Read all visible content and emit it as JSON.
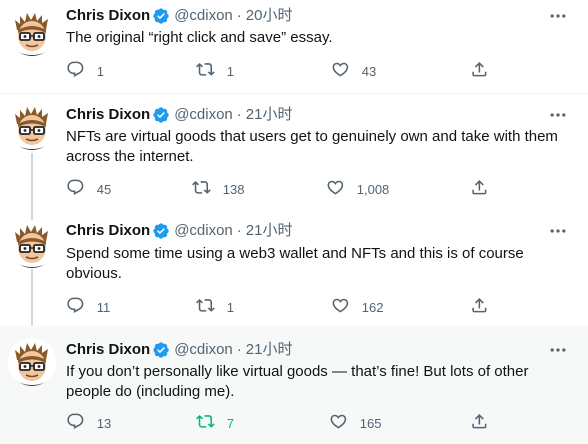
{
  "tweets": [
    {
      "name": "Chris Dixon",
      "handle": "@cdixon",
      "separator": "·",
      "time": "20小时",
      "text": "The original “right click and save” essay.",
      "replies": "1",
      "retweets": "1",
      "likes": "43",
      "retweeted": false
    },
    {
      "name": "Chris Dixon",
      "handle": "@cdixon",
      "separator": "·",
      "time": "21小时",
      "text": "NFTs are virtual goods that users get to genuinely own and take with them across the internet.",
      "replies": "45",
      "retweets": "138",
      "likes": "1,008",
      "retweeted": false
    },
    {
      "name": "Chris Dixon",
      "handle": "@cdixon",
      "separator": "·",
      "time": "21小时",
      "text": "Spend some time using a web3 wallet and NFTs and this is of course obvious.",
      "replies": "11",
      "retweets": "1",
      "likes": "162",
      "retweeted": false
    },
    {
      "name": "Chris Dixon",
      "handle": "@cdixon",
      "separator": "·",
      "time": "21小时",
      "text": "If you don’t personally like virtual goods — that’s fine! But lots of other people do (including me).",
      "replies": "13",
      "retweets": "7",
      "likes": "165",
      "retweeted": true
    }
  ],
  "colors": {
    "text_primary": "#0f1419",
    "text_secondary": "#536471",
    "verified_blue": "#1d9bf0",
    "retweet_green": "#00ba7c",
    "highlight_bg": "#f7f9f9"
  }
}
